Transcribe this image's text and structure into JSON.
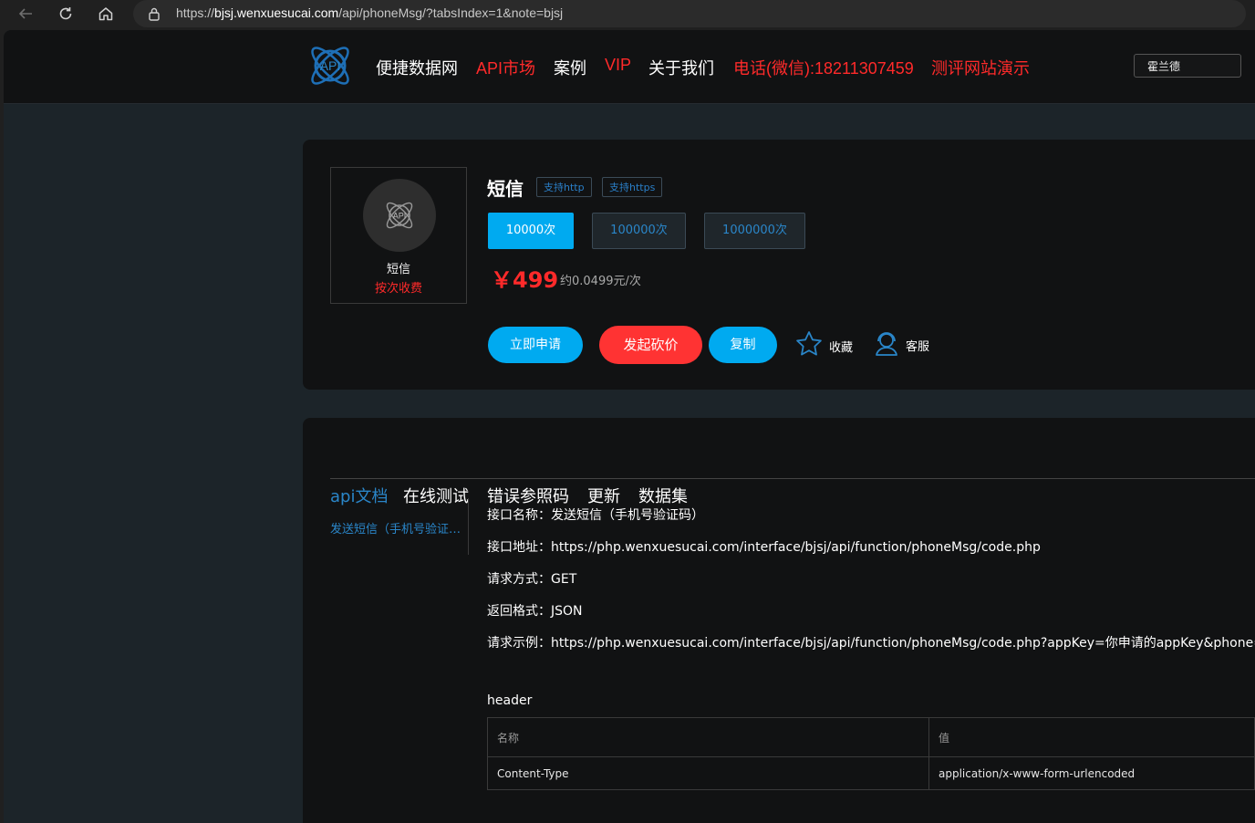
{
  "browser": {
    "url_prefix": "https://",
    "url_host": "bjsj.wenxuesucai.com",
    "url_path": "/api/phoneMsg/?tabsIndex=1&note=bjsj"
  },
  "header": {
    "logo_text": "API",
    "nav": [
      {
        "label": "便捷数据网"
      },
      {
        "label": "API市场"
      },
      {
        "label": "案例"
      },
      {
        "label": "VIP"
      },
      {
        "label": "关于我们"
      },
      {
        "label": "电话(微信):18211307459"
      },
      {
        "label": "测评网站演示"
      }
    ],
    "user": "霍兰德"
  },
  "product": {
    "icon_text": "API",
    "name": "短信",
    "billing": "按次收费",
    "title": "短信",
    "tags": [
      "支持http",
      "支持https"
    ],
    "quantities": [
      {
        "label": "10000次",
        "selected": true
      },
      {
        "label": "100000次",
        "selected": false
      },
      {
        "label": "1000000次",
        "selected": false
      }
    ],
    "price": "￥499",
    "unit_price": "约0.0499元/次",
    "actions": {
      "apply": "立即申请",
      "bargain": "发起砍价",
      "copy": "复制",
      "favorite": "收藏",
      "service": "客服"
    }
  },
  "docs": {
    "tabs": [
      "api文档",
      "在线测试",
      "错误参照码",
      "更新",
      "数据集"
    ],
    "active_tab": 0,
    "sidebar": [
      "发送短信（手机号验证码）"
    ],
    "rows": [
      "接口名称：发送短信（手机号验证码）",
      "接口地址：https://php.wenxuesucai.com/interface/bjsj/api/function/phoneMsg/code.php",
      "请求方式：GET",
      "返回格式：JSON",
      "请求示例：https://php.wenxuesucai.com/interface/bjsj/api/function/phoneMsg/code.php?appKey=你申请的appKey&phone=电话号码"
    ],
    "header_label": "header",
    "header_table": {
      "columns": [
        "名称",
        "值"
      ],
      "rows": [
        [
          "Content-Type",
          "application/x-www-form-urlencoded"
        ]
      ]
    }
  },
  "colors": {
    "accent_blue": "#00aaf0",
    "link_blue": "#2a86c9",
    "red": "#ff2a2a",
    "panel": "#111213",
    "page_bg": "#1c2429"
  }
}
